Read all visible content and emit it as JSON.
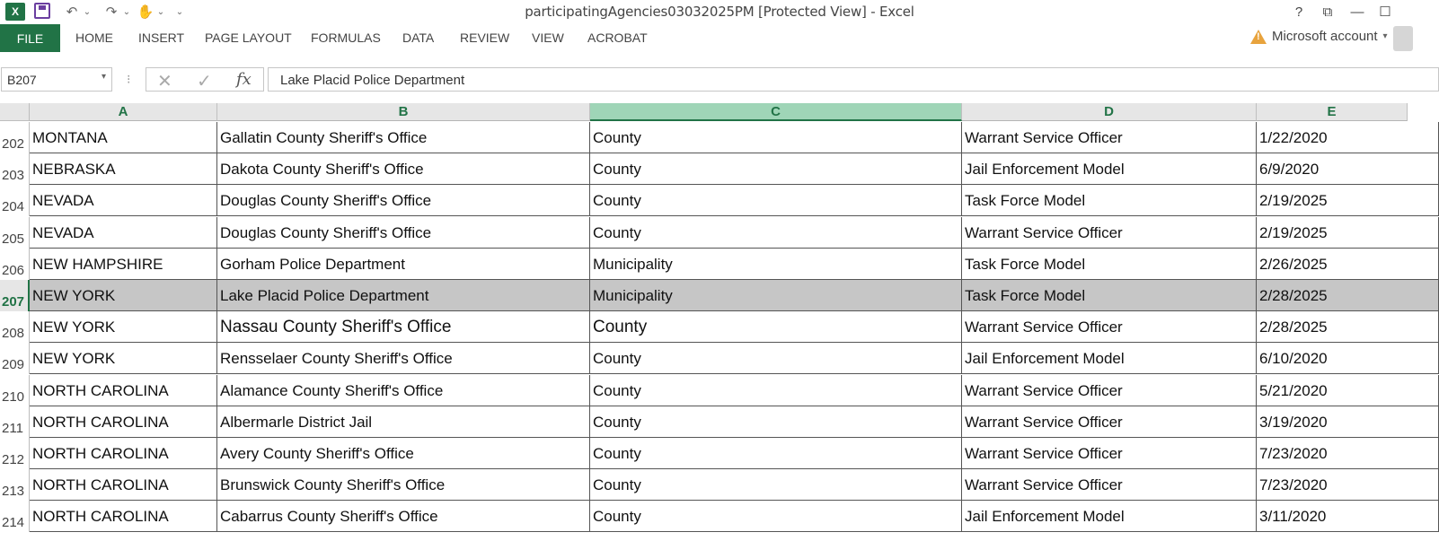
{
  "window": {
    "title": "participatingAgencies03032025PM  [Protected View] - Excel",
    "app_icon": "X",
    "help": "?",
    "restore": "⧉",
    "minimize": "—",
    "maximize": "☐"
  },
  "quick_access": {
    "undo": "↶",
    "redo": "↷",
    "touch": "✋",
    "more": "⌄"
  },
  "ribbon": {
    "file": "FILE",
    "tabs": [
      "HOME",
      "INSERT",
      "PAGE LAYOUT",
      "FORMULAS",
      "DATA",
      "REVIEW",
      "VIEW",
      "ACROBAT"
    ],
    "account": "Microsoft account",
    "account_caret": "▾"
  },
  "formula_bar": {
    "name_box": "B207",
    "separator": "⁝",
    "cancel": "✕",
    "enter": "✓",
    "fx": "fx",
    "value": "Lake Placid Police Department"
  },
  "grid": {
    "columns": [
      "A",
      "B",
      "C",
      "D",
      "E"
    ],
    "active_column": "C",
    "active_row": "207",
    "rows": [
      {
        "num": "202",
        "cells": [
          "MONTANA",
          "Gallatin County Sheriff's Office",
          "County",
          "Warrant Service Officer",
          "1/22/2020"
        ]
      },
      {
        "num": "203",
        "cells": [
          "NEBRASKA",
          "Dakota County Sheriff's Office",
          "County",
          "Jail Enforcement Model",
          "6/9/2020"
        ]
      },
      {
        "num": "204",
        "cells": [
          "NEVADA",
          "Douglas County Sheriff's Office",
          "County",
          "Task Force Model",
          "2/19/2025"
        ]
      },
      {
        "num": "205",
        "cells": [
          "NEVADA",
          "Douglas County Sheriff's Office",
          "County",
          "Warrant Service Officer",
          "2/19/2025"
        ]
      },
      {
        "num": "206",
        "cells": [
          "NEW HAMPSHIRE",
          "Gorham Police Department",
          "Municipality",
          "Task Force Model",
          "2/26/2025"
        ]
      },
      {
        "num": "207",
        "cells": [
          "NEW YORK",
          "Lake Placid Police Department",
          "Municipality",
          "Task Force Model",
          "2/28/2025"
        ]
      },
      {
        "num": "208",
        "cells": [
          "NEW YORK",
          "Nassau County Sheriff's Office",
          "County",
          "Warrant Service Officer",
          "2/28/2025"
        ]
      },
      {
        "num": "209",
        "cells": [
          "NEW YORK",
          "Rensselaer County Sheriff's Office",
          "County",
          "Jail Enforcement Model",
          "6/10/2020"
        ]
      },
      {
        "num": "210",
        "cells": [
          "NORTH CAROLINA",
          "Alamance County Sheriff's Office",
          "County",
          "Warrant Service Officer",
          "5/21/2020"
        ]
      },
      {
        "num": "211",
        "cells": [
          "NORTH CAROLINA",
          "Albermarle District Jail",
          "County",
          "Warrant Service Officer",
          "3/19/2020"
        ]
      },
      {
        "num": "212",
        "cells": [
          "NORTH CAROLINA",
          "Avery County Sheriff's Office",
          "County",
          "Warrant Service Officer",
          "7/23/2020"
        ]
      },
      {
        "num": "213",
        "cells": [
          "NORTH CAROLINA",
          "Brunswick County Sheriff's Office",
          "County",
          "Warrant Service Officer",
          "7/23/2020"
        ]
      },
      {
        "num": "214",
        "cells": [
          "NORTH CAROLINA",
          "Cabarrus County Sheriff's Office",
          "County",
          "Jail Enforcement Model",
          "3/11/2020"
        ]
      }
    ]
  },
  "colors": {
    "excel_green": "#217346",
    "selected_row_fill": "#c6c6c6",
    "active_column_header": "#9fd5b7"
  },
  "icons": {
    "app": "excel-icon",
    "save": "save-icon",
    "warning": "warning-icon"
  }
}
